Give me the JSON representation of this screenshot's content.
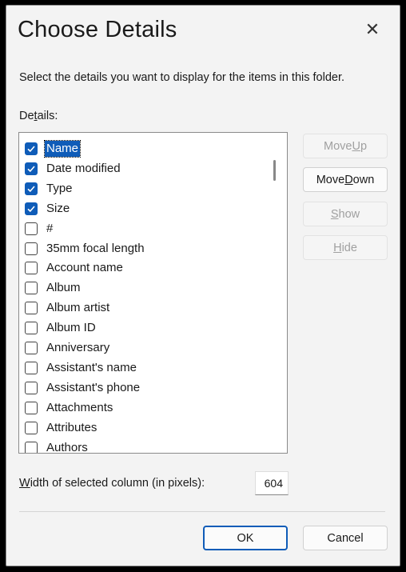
{
  "dialog": {
    "title": "Choose Details",
    "close_symbol": "✕",
    "instruction": "Select the details you want to display for the items in this folder.",
    "details_label_pre": "De",
    "details_label_accel": "t",
    "details_label_post": "ails:"
  },
  "list": {
    "items": [
      {
        "label": "Name",
        "checked": true,
        "selected": true
      },
      {
        "label": "Date modified",
        "checked": true
      },
      {
        "label": "Type",
        "checked": true
      },
      {
        "label": "Size",
        "checked": true
      },
      {
        "label": "#",
        "checked": false
      },
      {
        "label": "35mm focal length",
        "checked": false
      },
      {
        "label": "Account name",
        "checked": false
      },
      {
        "label": "Album",
        "checked": false
      },
      {
        "label": "Album artist",
        "checked": false
      },
      {
        "label": "Album ID",
        "checked": false
      },
      {
        "label": "Anniversary",
        "checked": false
      },
      {
        "label": "Assistant's name",
        "checked": false
      },
      {
        "label": "Assistant's phone",
        "checked": false
      },
      {
        "label": "Attachments",
        "checked": false
      },
      {
        "label": "Attributes",
        "checked": false
      },
      {
        "label": "Authors",
        "checked": false
      }
    ]
  },
  "buttons": {
    "move_up_pre": "Move ",
    "move_up_accel": "U",
    "move_up_post": "p",
    "move_down_pre": "Move ",
    "move_down_accel": "D",
    "move_down_post": "own",
    "show_accel": "S",
    "show_post": "how",
    "hide_accel": "H",
    "hide_post": "ide",
    "ok": "OK",
    "cancel": "Cancel"
  },
  "width": {
    "label_accel": "W",
    "label_post": "idth of selected column (in pixels):",
    "value": "604"
  },
  "colors": {
    "accent": "#0f5cb8",
    "background": "#f3f3f3",
    "disabled_text": "#a0a0a0"
  },
  "icons": {
    "close": "close-icon",
    "checkbox_checked": "checkmark-icon"
  }
}
